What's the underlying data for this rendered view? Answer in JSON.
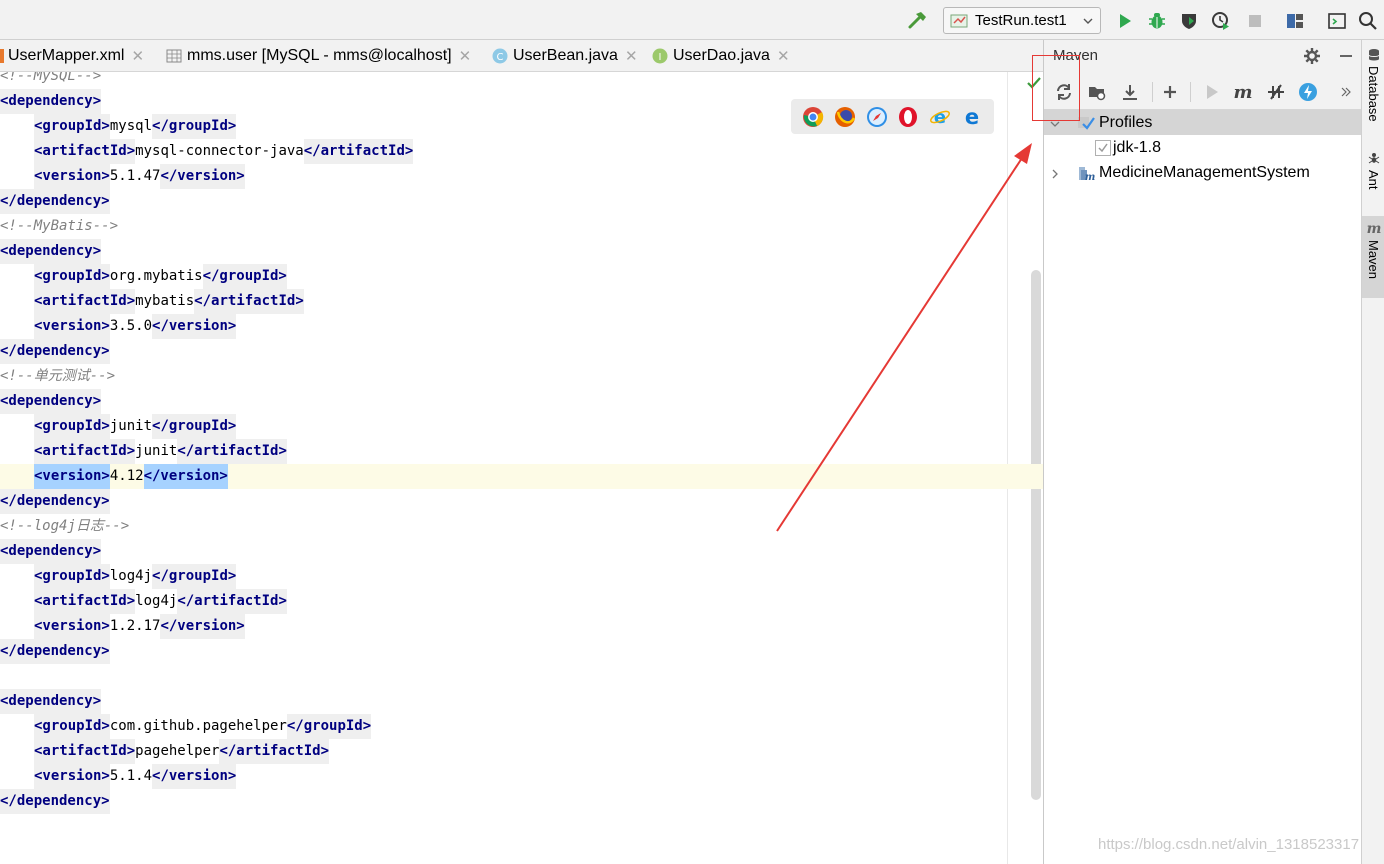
{
  "toolbar": {
    "run_config": "TestRun.test1",
    "colors": {
      "run": "#2fa84f",
      "debug": "#2fa84f",
      "hammer": "#4a9a3a"
    }
  },
  "tabs": [
    {
      "label": "UserMapper.xml",
      "icon": "xml-file-icon"
    },
    {
      "label": "mms.user [MySQL - mms@localhost]",
      "icon": "table-icon"
    },
    {
      "label": "UserBean.java",
      "icon": "class-icon"
    },
    {
      "label": "UserDao.java",
      "icon": "interface-icon"
    }
  ],
  "editor": {
    "lines": [
      {
        "kind": "comment",
        "text": "<!--MySQL-->"
      },
      {
        "kind": "tag",
        "indent": 0,
        "open": "dependency"
      },
      {
        "kind": "elem",
        "tag": "groupId",
        "value": "mysql"
      },
      {
        "kind": "elem",
        "tag": "artifactId",
        "value": "mysql-connector-java"
      },
      {
        "kind": "elem",
        "tag": "version",
        "value": "5.1.47"
      },
      {
        "kind": "close",
        "close": "dependency"
      },
      {
        "kind": "comment",
        "text": "<!--MyBatis-->"
      },
      {
        "kind": "tag",
        "indent": 0,
        "open": "dependency"
      },
      {
        "kind": "elem",
        "tag": "groupId",
        "value": "org.mybatis"
      },
      {
        "kind": "elem",
        "tag": "artifactId",
        "value": "mybatis"
      },
      {
        "kind": "elem",
        "tag": "version",
        "value": "3.5.0"
      },
      {
        "kind": "close",
        "close": "dependency"
      },
      {
        "kind": "comment",
        "text": "<!--单元测试-->"
      },
      {
        "kind": "tag",
        "indent": 0,
        "open": "dependency"
      },
      {
        "kind": "elem",
        "tag": "groupId",
        "value": "junit"
      },
      {
        "kind": "elem",
        "tag": "artifactId",
        "value": "junit"
      },
      {
        "kind": "elem",
        "tag": "version",
        "value": "4.12",
        "current": true
      },
      {
        "kind": "close",
        "close": "dependency"
      },
      {
        "kind": "comment",
        "text": "<!--log4j日志-->"
      },
      {
        "kind": "tag",
        "indent": 0,
        "open": "dependency"
      },
      {
        "kind": "elem",
        "tag": "groupId",
        "value": "log4j"
      },
      {
        "kind": "elem",
        "tag": "artifactId",
        "value": "log4j"
      },
      {
        "kind": "elem",
        "tag": "version",
        "value": "1.2.17"
      },
      {
        "kind": "close",
        "close": "dependency"
      },
      {
        "kind": "blank"
      },
      {
        "kind": "tag",
        "indent": 0,
        "open": "dependency"
      },
      {
        "kind": "elem",
        "tag": "groupId",
        "value": "com.github.pagehelper"
      },
      {
        "kind": "elem",
        "tag": "artifactId",
        "value": "pagehelper"
      },
      {
        "kind": "elem",
        "tag": "version",
        "value": "5.1.4"
      },
      {
        "kind": "close",
        "close": "dependency"
      }
    ]
  },
  "maven": {
    "title": "Maven",
    "tree": [
      {
        "label": "Profiles",
        "level": 0,
        "expanded": true,
        "selected": true,
        "icon": "profiles-icon"
      },
      {
        "label": "jdk-1.8",
        "level": 1,
        "checkbox": true
      },
      {
        "label": "MedicineManagementSystem",
        "level": 0,
        "expanded": false,
        "icon": "maven-module-icon"
      }
    ]
  },
  "side_tabs": [
    {
      "label": "Database",
      "icon": "database-icon"
    },
    {
      "label": "Ant",
      "icon": "ant-icon"
    },
    {
      "label": "Maven",
      "icon": "maven-icon",
      "active": true
    }
  ],
  "watermark": "https://blog.csdn.net/alvin_1318523317",
  "annotation_color": "#e53935"
}
